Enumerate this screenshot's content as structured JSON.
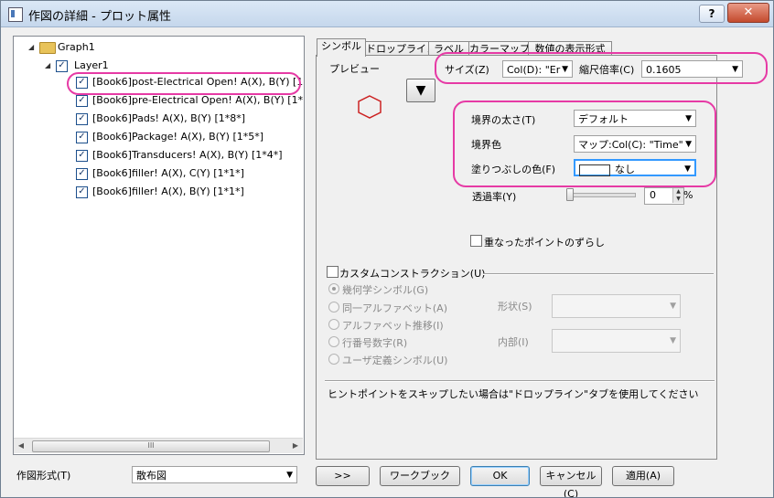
{
  "window": {
    "title": "作図の詳細 - プロット属性",
    "help": "?",
    "close": "✕"
  },
  "tree": {
    "root": "Graph1",
    "layer": "Layer1",
    "items": [
      "[Book6]post-Electrical Open! A(X), B(Y) [1",
      "[Book6]pre-Electrical Open! A(X), B(Y) [1*",
      "[Book6]Pads! A(X), B(Y) [1*8*]",
      "[Book6]Package! A(X), B(Y) [1*5*]",
      "[Book6]Transducers! A(X), B(Y) [1*4*]",
      "[Book6]filler! A(X), C(Y) [1*1*]",
      "[Book6]filler! A(X), B(Y) [1*1*]"
    ],
    "hscroll_grip": "III"
  },
  "plot_type": {
    "label": "作図形式(T)",
    "value": "散布図"
  },
  "tabs": [
    "シンボル",
    "ドロップライン",
    "ラベル",
    "カラーマップ",
    "数値の表示形式"
  ],
  "symbol_tab": {
    "preview_label": "プレビュー",
    "preview_button": "▼",
    "size_label": "サイズ(Z)",
    "size_value": "Col(D): \"Er",
    "scale_label": "縮尺倍率(C)",
    "scale_value": "0.1605",
    "edge_width_label": "境界の太さ(T)",
    "edge_width_value": "デフォルト",
    "edge_color_label": "境界色",
    "edge_color_value": "マップ:Col(C): \"Time\"",
    "fill_color_label": "塗りつぶしの色(F)",
    "fill_color_value": "なし",
    "transparency_label": "透過率(Y)",
    "transparency_value": "0",
    "transparency_unit": "%",
    "offset_label": "重なったポイントのずらし",
    "custom_construction_label": "カスタムコンストラクション(U)",
    "options": [
      "幾何学シンボル(G)",
      "同一アルファベット(A)",
      "アルファベット推移(I)",
      "行番号数字(R)",
      "ユーザ定義シンボル(U)"
    ],
    "shape_label": "形状(S)",
    "interior_label": "内部(I)",
    "hint": "ヒントポイントをスキップしたい場合は\"ドロップライン\"タブを使用してください"
  },
  "buttons": {
    "expand": ">>",
    "workbook": "ワークブック",
    "ok": "OK",
    "cancel": "キャンセル(C)",
    "apply": "適用(A)"
  },
  "colors": {
    "highlight": "#e63aa5",
    "symbol": "#cc2222",
    "selection": "#3399ff"
  }
}
